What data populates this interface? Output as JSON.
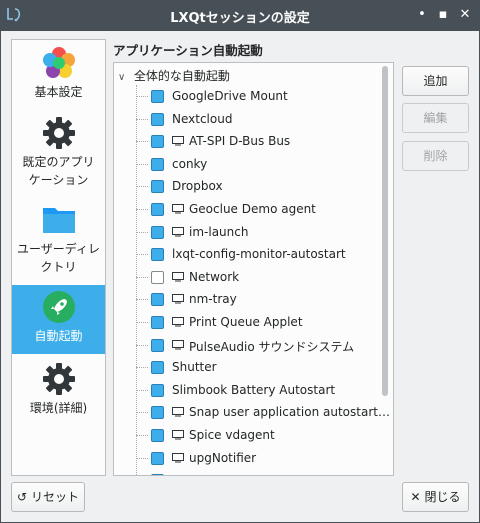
{
  "window": {
    "title": "LXQtセッションの設定",
    "minimize_glyph": "•",
    "maximize_glyph": "▪",
    "close_glyph": "✕"
  },
  "sidebar": {
    "items": [
      {
        "label": "基本設定",
        "icon": "color-flower-icon"
      },
      {
        "label": "既定のアプリ\nケーション",
        "icon": "gear-icon"
      },
      {
        "label": "ユーザーディレ\nクトリ",
        "icon": "folder-icon"
      },
      {
        "label": "自動起動",
        "icon": "rocket-icon",
        "active": true
      },
      {
        "label": "環境(詳細)",
        "icon": "gear-icon"
      }
    ]
  },
  "main": {
    "section_title": "アプリケーション自動起動",
    "root_label": "全体的な自動起動",
    "items": [
      {
        "label": "GoogleDrive Mount",
        "checked": true,
        "monitor": false
      },
      {
        "label": "Nextcloud",
        "checked": true,
        "monitor": false
      },
      {
        "label": "AT-SPI D-Bus Bus",
        "checked": true,
        "monitor": true
      },
      {
        "label": "conky",
        "checked": true,
        "monitor": false
      },
      {
        "label": "Dropbox",
        "checked": true,
        "monitor": false
      },
      {
        "label": "Geoclue Demo agent",
        "checked": true,
        "monitor": true
      },
      {
        "label": "im-launch",
        "checked": true,
        "monitor": true
      },
      {
        "label": "lxqt-config-monitor-autostart",
        "checked": true,
        "monitor": false
      },
      {
        "label": "Network",
        "checked": false,
        "monitor": true
      },
      {
        "label": "nm-tray",
        "checked": true,
        "monitor": true
      },
      {
        "label": "Print Queue Applet",
        "checked": true,
        "monitor": true
      },
      {
        "label": "PulseAudio サウンドシステム",
        "checked": true,
        "monitor": true
      },
      {
        "label": "Shutter",
        "checked": true,
        "monitor": false
      },
      {
        "label": "Slimbook Battery Autostart",
        "checked": true,
        "monitor": false
      },
      {
        "label": "Snap user application autostart…",
        "checked": true,
        "monitor": true
      },
      {
        "label": "Spice vdagent",
        "checked": true,
        "monitor": true
      },
      {
        "label": "upgNotifier",
        "checked": true,
        "monitor": true
      },
      {
        "label": "",
        "checked": true,
        "monitor": true
      }
    ]
  },
  "buttons": {
    "add": "追加",
    "edit": "編集",
    "delete": "削除",
    "reset": "リセット",
    "close": "閉じる"
  },
  "colors": {
    "accent": "#3daee9",
    "titlebar": "#475057"
  }
}
